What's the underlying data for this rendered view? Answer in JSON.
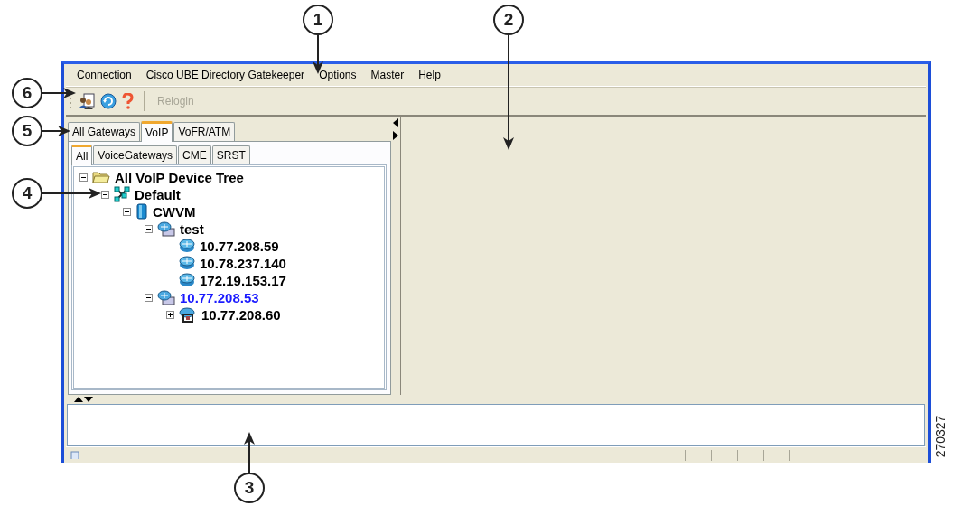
{
  "callouts": [
    {
      "number": "1"
    },
    {
      "number": "2"
    },
    {
      "number": "6"
    },
    {
      "number": "5"
    },
    {
      "number": "4"
    },
    {
      "number": "3"
    }
  ],
  "figure_id": "270327",
  "menu": [
    "Connection",
    "Cisco UBE Directory Gatekeeper",
    "Options",
    "Master",
    "Help"
  ],
  "toolbar": {
    "relogin": {
      "label": "Relogin",
      "disabled": true
    }
  },
  "outer_tabs": [
    {
      "label": "All Gateways",
      "selected": false
    },
    {
      "label": "VoIP",
      "selected": true
    },
    {
      "label": "VoFR/ATM",
      "selected": false
    }
  ],
  "inner_tabs": [
    {
      "label": "All",
      "selected": true
    },
    {
      "label": "VoiceGateways",
      "selected": false
    },
    {
      "label": "CME",
      "selected": false
    },
    {
      "label": "SRST",
      "selected": false
    }
  ],
  "tree": {
    "label": "All VoIP Device Tree",
    "kind": "folder",
    "expanded": true,
    "selected": false,
    "children": [
      {
        "label": "Default",
        "kind": "network",
        "expanded": true,
        "selected": false,
        "children": [
          {
            "label": "CWVM",
            "kind": "server",
            "expanded": true,
            "selected": false,
            "children": [
              {
                "label": "test",
                "kind": "cluster",
                "expanded": true,
                "selected": false,
                "children": [
                  {
                    "label": "10.77.208.59",
                    "kind": "router",
                    "selected": false
                  },
                  {
                    "label": "10.78.237.140",
                    "kind": "router",
                    "selected": false
                  },
                  {
                    "label": "172.19.153.17",
                    "kind": "router",
                    "selected": false
                  }
                ]
              },
              {
                "label": "10.77.208.53",
                "kind": "cluster",
                "expanded": true,
                "selected": true,
                "children": [
                  {
                    "label": "10.77.208.60",
                    "kind": "gateway",
                    "expanded": false,
                    "selected": false
                  }
                ]
              }
            ]
          }
        ]
      }
    ]
  }
}
